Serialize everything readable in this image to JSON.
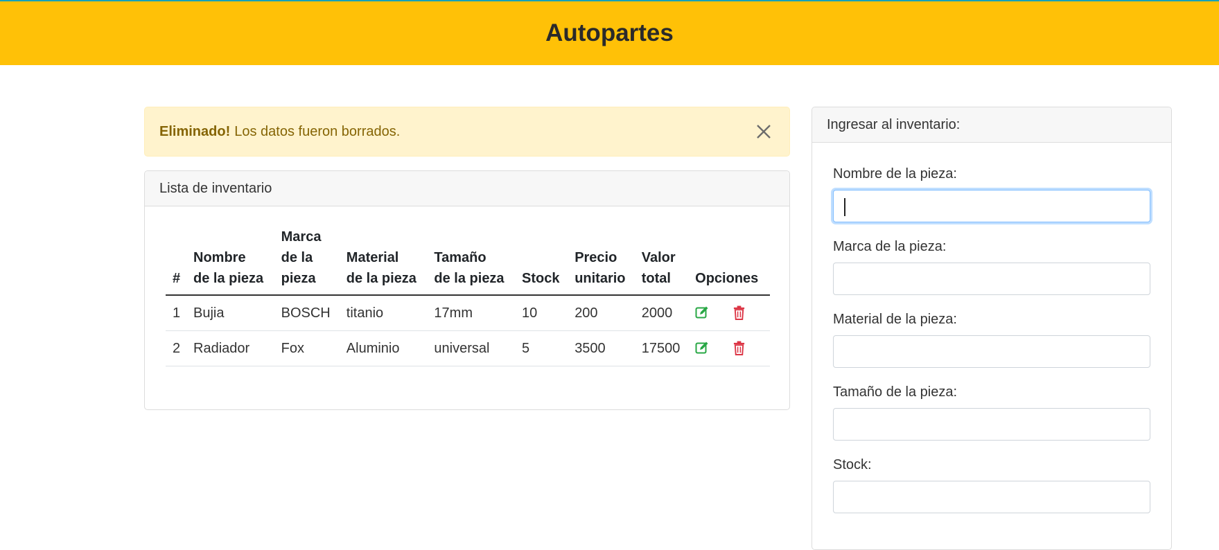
{
  "navbar": {
    "title": "Autopartes"
  },
  "alert": {
    "strong": "Eliminado!",
    "message": "Los datos fueron borrados."
  },
  "list": {
    "title": "Lista de inventario",
    "headers": [
      [
        "#"
      ],
      [
        "Nombre",
        "de la pieza"
      ],
      [
        "Marca",
        "de la",
        "pieza"
      ],
      [
        "Material",
        "de la pieza"
      ],
      [
        "Tamaño",
        "de la pieza"
      ],
      [
        "Stock"
      ],
      [
        "Precio",
        "unitario"
      ],
      [
        "Valor",
        "total"
      ],
      [
        "Opciones"
      ]
    ],
    "rows": [
      {
        "num": "1",
        "nombre": "Bujia",
        "marca": "BOSCH",
        "material": "titanio",
        "tamano": "17mm",
        "stock": "10",
        "precio": "200",
        "total": "2000"
      },
      {
        "num": "2",
        "nombre": "Radiador",
        "marca": "Fox",
        "material": "Aluminio",
        "tamano": "universal",
        "stock": "5",
        "precio": "3500",
        "total": "17500"
      }
    ]
  },
  "form": {
    "title": "Ingresar al inventario:",
    "fields": [
      {
        "label": "Nombre de la pieza:",
        "value": ""
      },
      {
        "label": "Marca de la pieza:",
        "value": ""
      },
      {
        "label": "Material de la pieza:",
        "value": ""
      },
      {
        "label": "Tamaño de la pieza:",
        "value": ""
      },
      {
        "label": "Stock:",
        "value": ""
      }
    ]
  },
  "icons": {
    "close": "close-icon",
    "edit": "edit-icon",
    "delete": "trash-icon"
  },
  "colors": {
    "navbar": "#ffc107",
    "alert_bg": "#fff3cd",
    "alert_text": "#856404",
    "edit": "#28a745",
    "delete": "#dc3545",
    "focus": "#80bdff"
  }
}
